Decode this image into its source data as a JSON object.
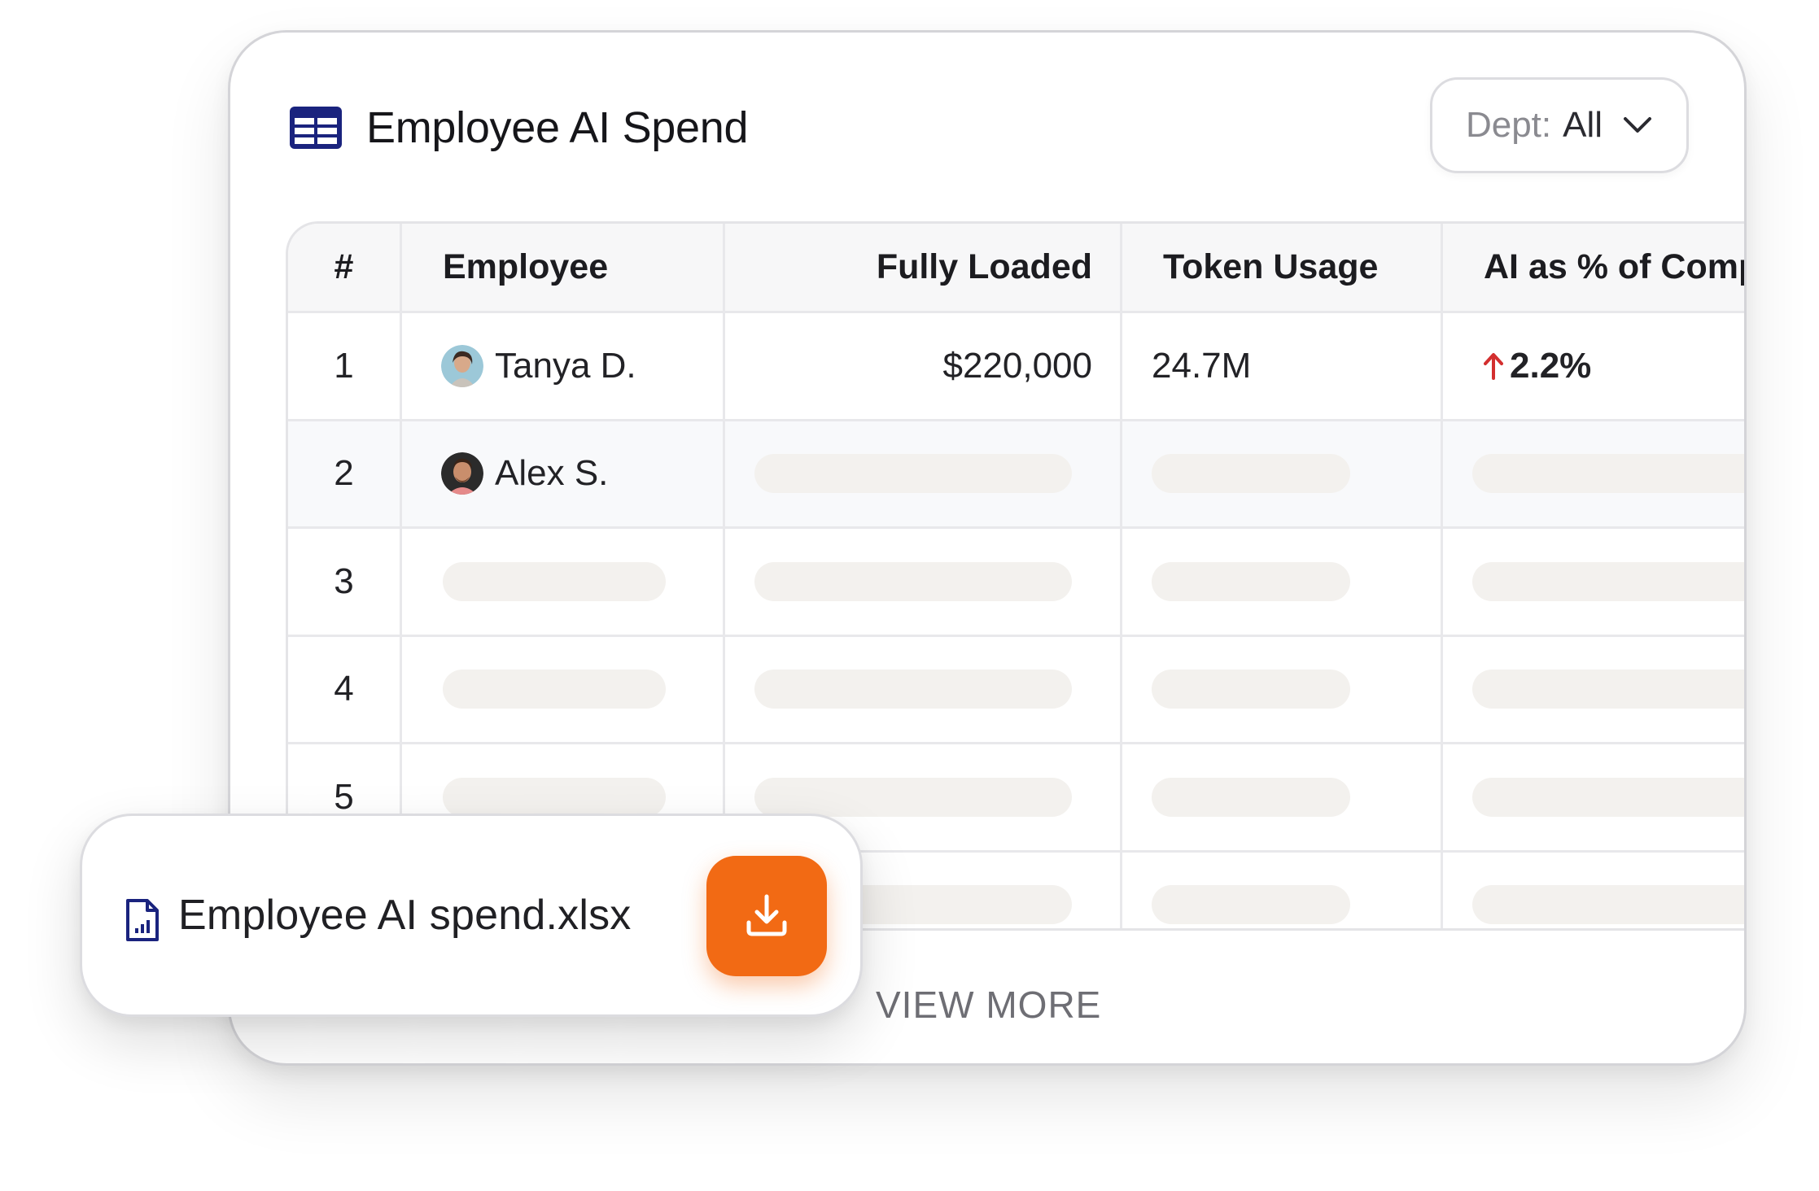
{
  "card": {
    "title": "Employee AI Spend",
    "dept_filter": {
      "label": "Dept:",
      "value": "All"
    }
  },
  "table": {
    "columns": [
      "#",
      "Employee",
      "Fully Loaded",
      "Token Usage",
      "AI as % of Comp"
    ],
    "rows": [
      {
        "index": "1",
        "employee": "Tanya D.",
        "fully_loaded": "$220,000",
        "token_usage": "24.7M",
        "ai_pct": "2.2%",
        "trend": "up"
      },
      {
        "index": "2",
        "employee": "Alex S."
      },
      {
        "index": "3"
      },
      {
        "index": "4"
      },
      {
        "index": "5"
      },
      {
        "index": ""
      }
    ]
  },
  "footer": {
    "view_more": "VIEW MORE"
  },
  "file_chip": {
    "filename": "Employee AI spend.xlsx"
  },
  "colors": {
    "accent": "#f26a14",
    "icon_navy": "#1a237e",
    "trend_up": "#d32f2f",
    "skeleton": "#f3f1ee"
  },
  "icons": {
    "table": "table-icon",
    "chevron": "chevron-down-icon",
    "trend": "arrow-up-icon",
    "file": "spreadsheet-file-icon",
    "download": "download-icon"
  }
}
